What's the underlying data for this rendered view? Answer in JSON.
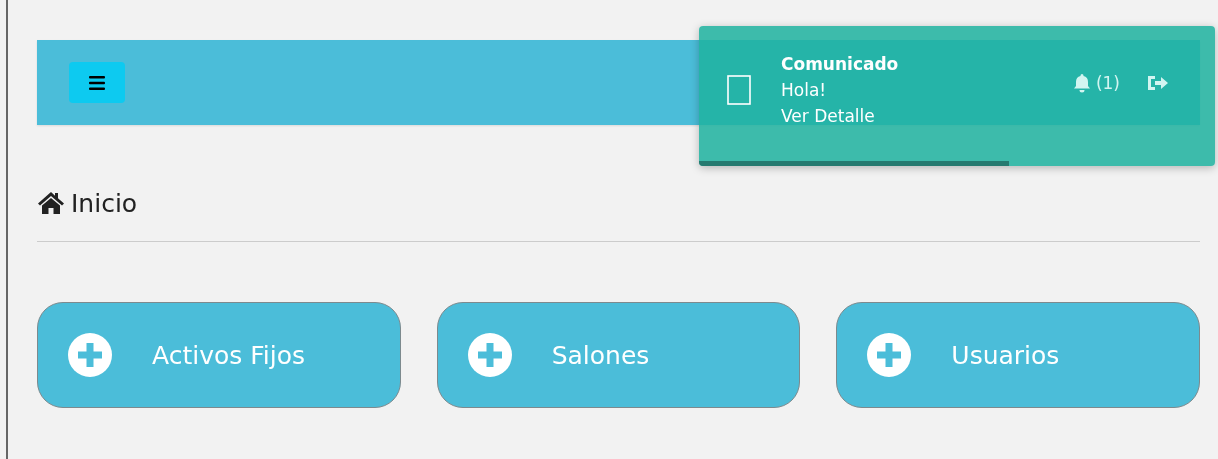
{
  "header": {
    "notification_count": "(1)"
  },
  "page": {
    "title": "Inicio"
  },
  "shortcuts": [
    {
      "label": "Activos Fijos"
    },
    {
      "label": "Salones"
    },
    {
      "label": "Usuarios"
    }
  ],
  "toast": {
    "title": "Comunicado",
    "message": "Hola!",
    "link": "Ver Detalle",
    "level": 0.6
  }
}
